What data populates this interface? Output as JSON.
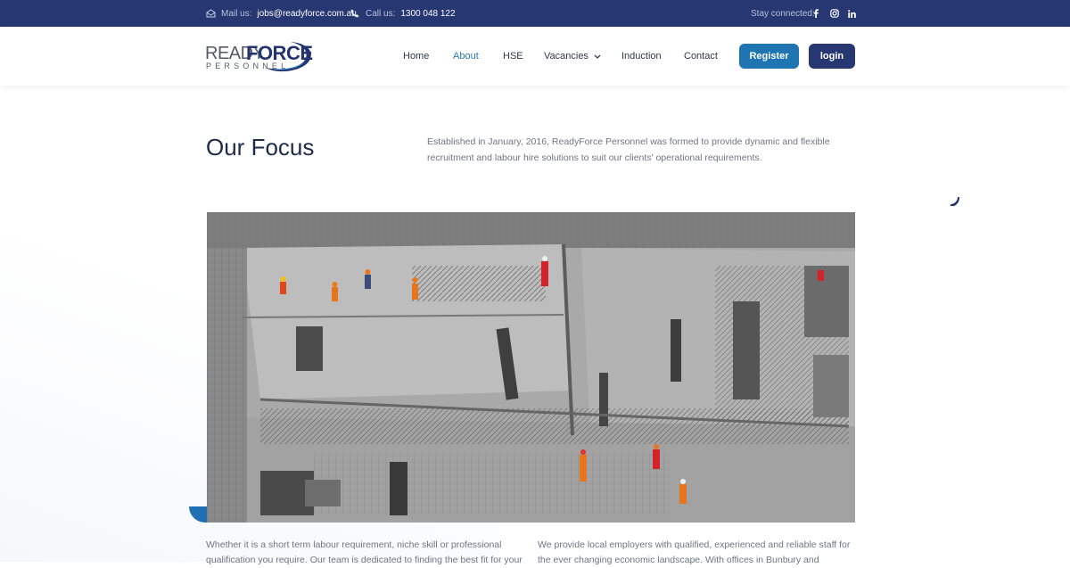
{
  "topbar": {
    "mail_label": "Mail us:",
    "mail_value": "jobs@readyforce.com.au",
    "call_label": "Call us:",
    "call_value": "1300 048 122",
    "stay_connected": "Stay connected:",
    "social_icons": [
      "facebook-icon",
      "instagram-icon",
      "linkedin-icon"
    ]
  },
  "logo": {
    "ready": "READY",
    "force": "FORCE",
    "personnel": "PERSONNEL"
  },
  "nav": {
    "items": [
      {
        "label": "Home"
      },
      {
        "label": "About",
        "active": true
      },
      {
        "label": "HSE"
      },
      {
        "label": "Vacancies",
        "has_dropdown": true
      },
      {
        "label": "Induction"
      },
      {
        "label": "Contact"
      }
    ],
    "register_label": "Register",
    "login_label": "login"
  },
  "hero": {
    "title": "Our Focus",
    "intro": "Established in January, 2016, ReadyForce Personnel was formed to provide dynamic and flexible recruitment and labour hire solutions to suit our clients' operational requirements."
  },
  "content": {
    "left_text": "Whether it is a short term labour requirement, niche skill or professional qualification you require. Our team is dedicated to finding the best fit for your",
    "right_text": "We provide local employers with qualified, experienced and reliable staff for the ever changing economic landscape. With offices in Bunbury and"
  },
  "colors": {
    "topbar_bg": "#263771",
    "accent_blue": "#1f74b2",
    "active_nav": "#2e79b8",
    "login_bg": "#263771",
    "title_color": "#1d2a4a",
    "body_text": "#6e7684"
  }
}
